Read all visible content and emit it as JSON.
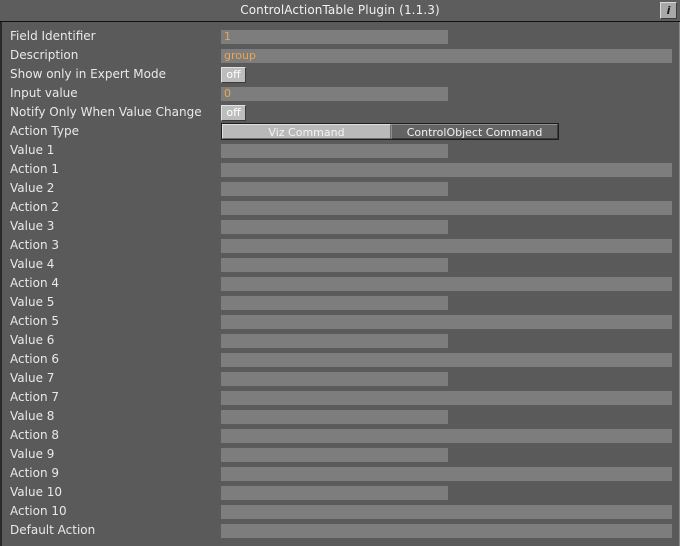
{
  "window": {
    "title": "ControlActionTable Plugin (1.1.3)",
    "info_button_label": "i"
  },
  "colors": {
    "panel_background": "#5a5a5a",
    "titlebar_background": "#5d5d5d",
    "field_background": "#7d7d7d",
    "field_value_text": "#e8a852",
    "label_text": "#e9e9e9",
    "button_face": "#bdbdbd",
    "segment_selected": "#b9b9b9",
    "segment_unselected": "#636363"
  },
  "form": {
    "rows": [
      {
        "label": "Field Identifier",
        "control": "text",
        "value": "1",
        "width": "short"
      },
      {
        "label": "Description",
        "control": "text",
        "value": "group",
        "width": "long"
      },
      {
        "label": "Show only in Expert Mode",
        "control": "toggle",
        "value": "off"
      },
      {
        "label": "Input value",
        "control": "text",
        "value": "0",
        "width": "short"
      },
      {
        "label": "Notify Only When Value Change",
        "control": "toggle",
        "value": "off"
      },
      {
        "label": "Action Type",
        "control": "segmented",
        "options": [
          "Viz Command",
          "ControlObject Command"
        ],
        "selected": "Viz Command"
      },
      {
        "label": "Value 1",
        "control": "text",
        "value": "",
        "width": "short"
      },
      {
        "label": "Action 1",
        "control": "text",
        "value": "",
        "width": "long"
      },
      {
        "label": "Value 2",
        "control": "text",
        "value": "",
        "width": "short"
      },
      {
        "label": "Action 2",
        "control": "text",
        "value": "",
        "width": "long"
      },
      {
        "label": "Value 3",
        "control": "text",
        "value": "",
        "width": "short"
      },
      {
        "label": "Action 3",
        "control": "text",
        "value": "",
        "width": "long"
      },
      {
        "label": "Value 4",
        "control": "text",
        "value": "",
        "width": "short"
      },
      {
        "label": "Action 4",
        "control": "text",
        "value": "",
        "width": "long"
      },
      {
        "label": "Value 5",
        "control": "text",
        "value": "",
        "width": "short"
      },
      {
        "label": "Action 5",
        "control": "text",
        "value": "",
        "width": "long"
      },
      {
        "label": "Value 6",
        "control": "text",
        "value": "",
        "width": "short"
      },
      {
        "label": "Action 6",
        "control": "text",
        "value": "",
        "width": "long"
      },
      {
        "label": "Value 7",
        "control": "text",
        "value": "",
        "width": "short"
      },
      {
        "label": "Action 7",
        "control": "text",
        "value": "",
        "width": "long"
      },
      {
        "label": "Value 8",
        "control": "text",
        "value": "",
        "width": "short"
      },
      {
        "label": "Action 8",
        "control": "text",
        "value": "",
        "width": "long"
      },
      {
        "label": "Value 9",
        "control": "text",
        "value": "",
        "width": "short"
      },
      {
        "label": "Action 9",
        "control": "text",
        "value": "",
        "width": "long"
      },
      {
        "label": "Value 10",
        "control": "text",
        "value": "",
        "width": "short"
      },
      {
        "label": "Action 10",
        "control": "text",
        "value": "",
        "width": "long"
      },
      {
        "label": "Default Action",
        "control": "text",
        "value": "",
        "width": "long"
      }
    ]
  }
}
